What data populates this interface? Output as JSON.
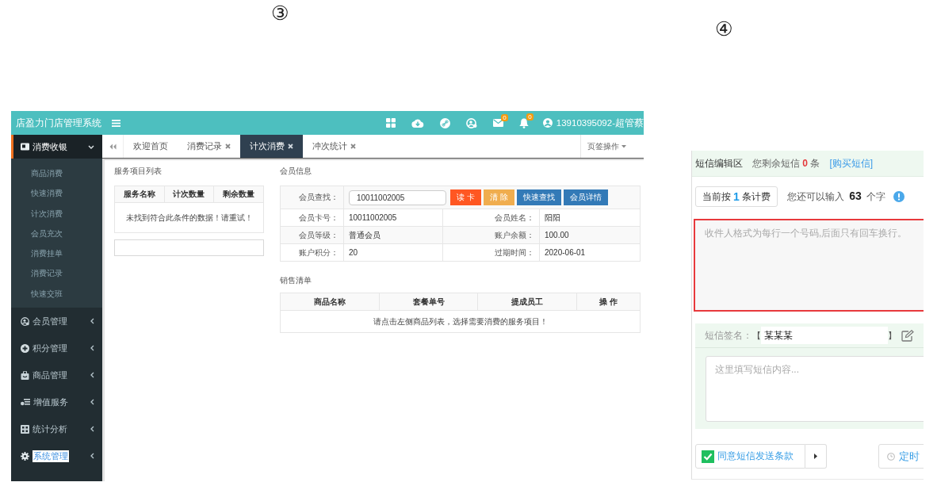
{
  "left_panel": {
    "marker": "③",
    "header": {
      "title": "店盈力门店管理系统",
      "notifications": [
        {
          "kind": "mail",
          "count": "0"
        },
        {
          "kind": "bell",
          "count": "0"
        }
      ],
      "user": "13910395092-超管蔡"
    },
    "sidebar": {
      "items": [
        {
          "label": "消费收银",
          "selected": true,
          "expanded": true,
          "text_selected": false,
          "children": [
            {
              "label": "商品消费"
            },
            {
              "label": "快速消费"
            },
            {
              "label": "计次消费"
            },
            {
              "label": "会员充次"
            },
            {
              "label": "消费挂单"
            },
            {
              "label": "消费记录"
            },
            {
              "label": "快速交班"
            }
          ]
        },
        {
          "label": "会员管理",
          "selected": false,
          "expanded": false,
          "text_selected": false
        },
        {
          "label": "积分管理",
          "selected": false,
          "expanded": false,
          "text_selected": false
        },
        {
          "label": "商品管理",
          "selected": false,
          "expanded": false,
          "text_selected": false
        },
        {
          "label": "增值服务",
          "selected": false,
          "expanded": false,
          "text_selected": false
        },
        {
          "label": "统计分析",
          "selected": false,
          "expanded": false,
          "text_selected": false
        },
        {
          "label": "系统管理",
          "selected": false,
          "expanded": false,
          "text_selected": true
        }
      ]
    },
    "tabs": [
      {
        "label": "欢迎首页",
        "closable": false,
        "selected": false
      },
      {
        "label": "消费记录",
        "closable": true,
        "selected": false
      },
      {
        "label": "计次消费",
        "closable": true,
        "selected": true
      },
      {
        "label": "冲次统计",
        "closable": true,
        "selected": false
      }
    ],
    "tab_menu": "页签操作",
    "service_list": {
      "title": "服务项目列表",
      "columns": [
        "服务名称",
        "计次数量",
        "剩余数量"
      ],
      "empty_message": "未找到符合此条件的数据！请重试！"
    },
    "member_info": {
      "title": "会员信息",
      "search": {
        "label": "会员查找：",
        "value": "10011002005"
      },
      "buttons": [
        {
          "label": "读 卡",
          "kind": "danger"
        },
        {
          "label": "清 除",
          "kind": "warning"
        },
        {
          "label": "快速查找",
          "kind": "primary"
        },
        {
          "label": "会员详情",
          "kind": "primary"
        }
      ],
      "fields": [
        {
          "label": "会员卡号：",
          "value": "10011002005"
        },
        {
          "label": "会员姓名：",
          "value": "阳阳"
        },
        {
          "label": "会员等级：",
          "value": "普通会员"
        },
        {
          "label": "账户余额：",
          "value": "100.00"
        },
        {
          "label": "账户积分：",
          "value": "20"
        },
        {
          "label": "过期时间：",
          "value": "2020-06-01"
        }
      ]
    },
    "sales_list": {
      "title": "销售清单",
      "columns": [
        "商品名称",
        "套餐单号",
        "提成员工",
        "操 作"
      ],
      "empty_message": "请点击左侧商品列表，选择需要消费的服务项目！"
    }
  },
  "right_panel": {
    "marker": "④",
    "sms_editor": {
      "title": "短信编辑区",
      "remaining": "您剩余短信 **0** 条",
      "buy_link": "[购买短信]",
      "billing": "当前按 **1** 条计费",
      "chars_left": "您还可以输入 **63** 个字",
      "recipients": {
        "placeholder": "收件人格式为每行一个号码,后面只有回车换行。",
        "invalid": true
      },
      "signature": {
        "label": "短信签名：",
        "open": "【",
        "value": "某某某",
        "close": "】"
      },
      "content": {
        "placeholder": "这里填写短信内容..."
      },
      "agree": {
        "label": "同意短信发送条款",
        "checked": true
      },
      "schedule_button": "定时"
    }
  }
}
